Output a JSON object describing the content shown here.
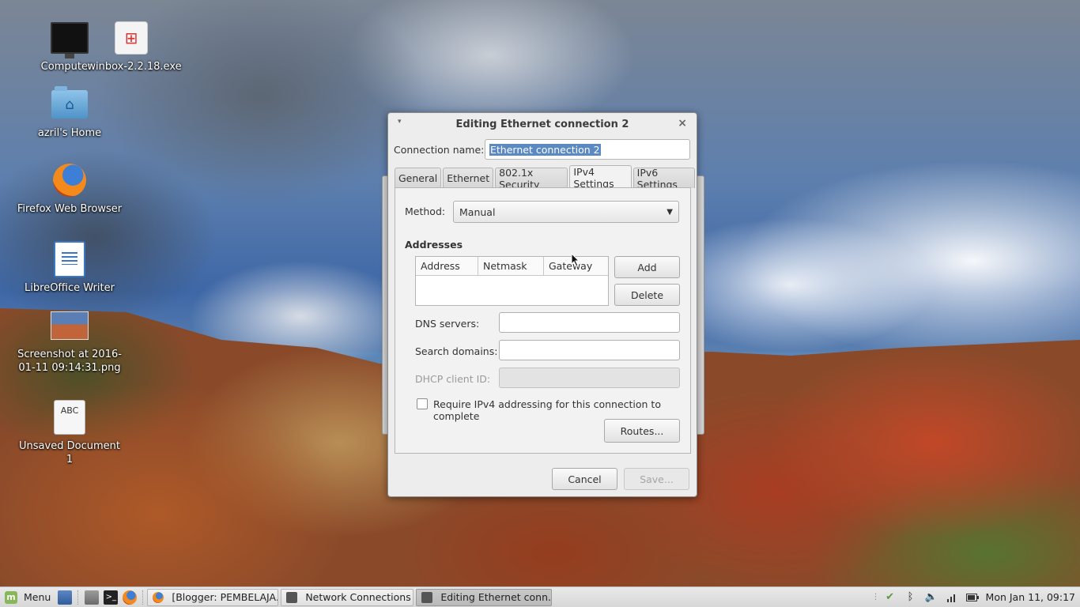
{
  "desktop": {
    "icons": [
      {
        "label": "Computer"
      },
      {
        "label": "winbox-2.2.18.exe"
      },
      {
        "label": "azril's Home"
      },
      {
        "label": "Firefox Web Browser"
      },
      {
        "label": "LibreOffice Writer"
      },
      {
        "label": "Screenshot at 2016-01-11 09:14:31.png",
        "line1": "Screenshot at 2016-",
        "line2": "01-11 09:14:31.png"
      },
      {
        "label": "Unsaved Document 1",
        "glyph": "ABC"
      }
    ]
  },
  "dialog": {
    "title": "Editing Ethernet connection 2",
    "close_glyph": "×",
    "menu_glyph": "▾",
    "connection_name_label": "Connection name:",
    "connection_name_value": "Ethernet connection 2",
    "tabs": [
      {
        "label": "General",
        "active": false
      },
      {
        "label": "Ethernet",
        "active": false
      },
      {
        "label": "802.1x Security",
        "active": false
      },
      {
        "label": "IPv4 Settings",
        "active": true
      },
      {
        "label": "IPv6 Settings",
        "active": false
      }
    ],
    "ipv4": {
      "method_label": "Method:",
      "method_value": "Manual",
      "addresses_heading": "Addresses",
      "columns": [
        "Address",
        "Netmask",
        "Gateway"
      ],
      "add_label": "Add",
      "delete_label": "Delete",
      "dns_label": "DNS servers:",
      "dns_value": "",
      "search_label": "Search domains:",
      "search_value": "",
      "dhcp_label": "DHCP client ID:",
      "dhcp_value": "",
      "require_label": "Require IPv4 addressing for this connection to complete",
      "require_checked": false,
      "routes_label": "Routes..."
    },
    "cancel_label": "Cancel",
    "save_label": "Save..."
  },
  "taskbar": {
    "menu_label": "Menu",
    "tasks": [
      {
        "label": "[Blogger: PEMBELAJA...",
        "active": false
      },
      {
        "label": "Network Connections",
        "active": false
      },
      {
        "label": "Editing Ethernet conn...",
        "active": true
      }
    ],
    "clock": "Mon Jan 11, 09:17"
  },
  "colors": {
    "selection": "#5a89c4",
    "mint_green": "#87b758"
  }
}
